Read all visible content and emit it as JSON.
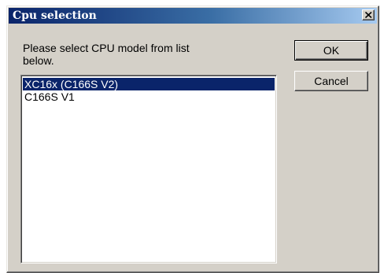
{
  "window": {
    "title": "Cpu selection",
    "close_icon": "close-icon"
  },
  "prompt": {
    "text": "Please select CPU model from list below."
  },
  "cpu_list": {
    "items": [
      "XC16x (C166S V2)",
      "C166S V1"
    ],
    "selected": "XC16x (C166S V2)"
  },
  "buttons": {
    "ok_label": "OK",
    "cancel_label": "Cancel"
  },
  "colors": {
    "title_gradient_start": "#0a246a",
    "title_gradient_end": "#a6caf0",
    "dialog_face": "#d4d0c8",
    "selection": "#0a246a"
  }
}
